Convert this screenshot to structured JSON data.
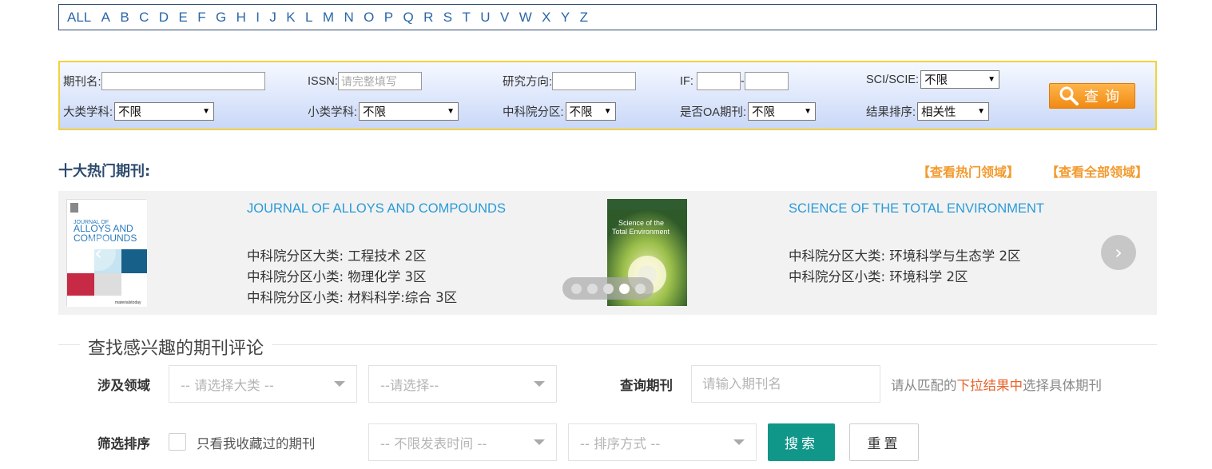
{
  "alphabet": [
    "ALL",
    "A",
    "B",
    "C",
    "D",
    "E",
    "F",
    "G",
    "H",
    "I",
    "J",
    "K",
    "L",
    "M",
    "N",
    "O",
    "P",
    "Q",
    "R",
    "S",
    "T",
    "U",
    "V",
    "W",
    "X",
    "Y",
    "Z"
  ],
  "search": {
    "journal_name_label": "期刊名:",
    "journal_name_value": "",
    "issn_label": "ISSN:",
    "issn_placeholder": "请完整填写",
    "research_label": "研究方向:",
    "research_value": "",
    "if_label": "IF:",
    "if_sep": "-",
    "sci_label": "SCI/SCIE:",
    "sci_value": "不限",
    "major_label": "大类学科:",
    "major_value": "不限",
    "minor_label": "小类学科:",
    "minor_value": "不限",
    "cas_label": "中科院分区:",
    "cas_value": "不限",
    "oa_label": "是否OA期刊:",
    "oa_value": "不限",
    "sort_label": "结果排序:",
    "sort_value": "相关性",
    "query_button": "查询"
  },
  "hot": {
    "title": "十大热门期刊:",
    "link_hot": "【查看热门领域】",
    "link_all": "【查看全部领域】",
    "journals": [
      {
        "title": "JOURNAL OF ALLOYS AND COMPOUNDS",
        "cover_text_1": "JOURNAL OF",
        "cover_text_2": "ALLOYS AND",
        "cover_text_3": "COMPOUNDS",
        "cover_brand": "materialstoday",
        "lines": [
          "中科院分区大类:  工程技术 2区",
          "中科院分区小类:  物理化学 3区",
          "中科院分区小类:  材料科学:综合 3区"
        ]
      },
      {
        "title": "SCIENCE OF THE TOTAL ENVIRONMENT",
        "cover_text_1": "Science of the",
        "cover_text_2": "Total Environment",
        "lines": [
          "中科院分区大类:  环境科学与生态学 2区",
          "中科院分区小类:  环境科学 2区"
        ]
      }
    ],
    "dots_count": 5,
    "active_dot": 3
  },
  "review": {
    "title": "查找感兴趣的期刊评论",
    "field_label": "涉及领域",
    "major_placeholder": "-- 请选择大类 --",
    "minor_placeholder": "--请选择--",
    "query_label": "查询期刊",
    "query_placeholder": "请输入期刊名",
    "hint_pre": "请从匹配的",
    "hint_hl": "下拉结果中",
    "hint_post": "选择具体期刊",
    "filter_label": "筛选排序",
    "only_fav": "只看我收藏过的期刊",
    "time_placeholder": "-- 不限发表时间 --",
    "order_placeholder": "-- 排序方式 --",
    "search_button": "搜索",
    "reset_button": "重置"
  },
  "colors": {
    "link_blue": "#2b67a8",
    "journal_blue": "#2a9ad8",
    "orange": "#f29a2e",
    "teal": "#11968a"
  }
}
